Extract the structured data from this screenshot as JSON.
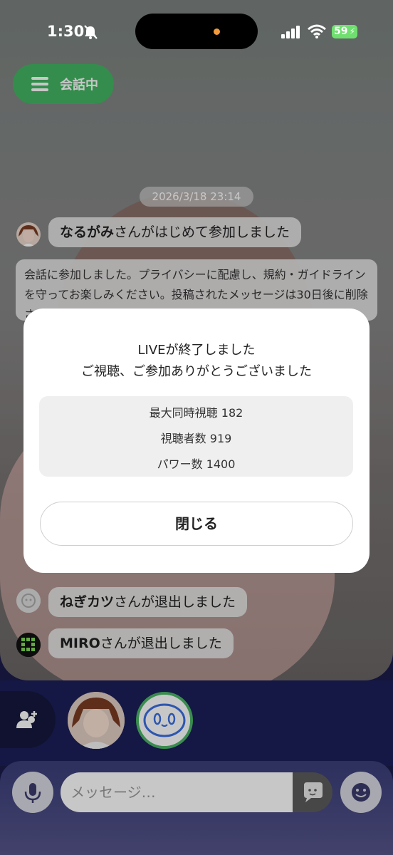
{
  "status_bar": {
    "time": "1:30",
    "battery": "59",
    "icons": [
      "silent-bell-icon",
      "signal-icon",
      "wifi-icon",
      "battery-icon"
    ]
  },
  "header": {
    "talk_pill_label": "会話中"
  },
  "chat": {
    "date": "2026/3/18 23:14",
    "join_message": {
      "name": "なるがみ",
      "text": "さんがはじめて参加しました"
    },
    "system_message": "会話に参加しました。プライバシーに配慮し、規約・ガイドラインを守ってお楽しみください。投稿されたメッセージは30日後に削除されます。",
    "leave_messages": [
      {
        "name": "ねぎカツ",
        "text": "さんが退出しました"
      },
      {
        "name": "MIRO",
        "text": "さんが退出しました"
      }
    ]
  },
  "modal": {
    "title": "LIVEが終了しました",
    "subtitle": "ご視聴、ご参加ありがとうございました",
    "stats": [
      {
        "label": "最大同時視聴",
        "value": "182"
      },
      {
        "label": "視聴者数",
        "value": "919"
      },
      {
        "label": "パワー数",
        "value": "1400"
      }
    ],
    "close_label": "閉じる"
  },
  "input": {
    "placeholder": "メッセージ…"
  },
  "colors": {
    "accent_green": "#43b562",
    "modal_bg": "#ffffff",
    "stats_bg": "#efefef",
    "bottom_bg": "#1b1f58"
  }
}
